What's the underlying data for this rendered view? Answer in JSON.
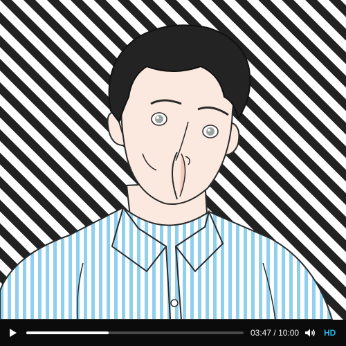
{
  "player": {
    "current_time": "03:47",
    "separator": "/",
    "duration": "10:00",
    "progress_fraction": 0.378,
    "quality_label": "HD",
    "accent_color": "#2ab5e8"
  },
  "icons": {
    "play": "play-icon",
    "volume": "volume-icon"
  }
}
